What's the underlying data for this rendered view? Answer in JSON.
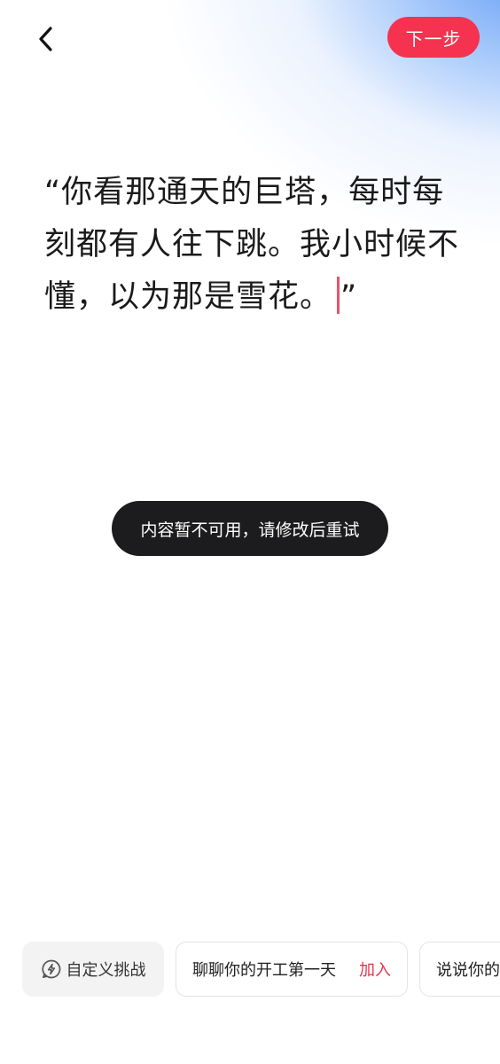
{
  "header": {
    "back_icon": "chevron-left-icon",
    "next_label": "下一步",
    "accent_color": "#f5324f"
  },
  "editor": {
    "text": "“你看那通天的巨塔，每时每刻都有人往下跳。我小时候不懂，以为那是雪花。",
    "closing_quote": "”",
    "caret_color": "#f0506a"
  },
  "toast": {
    "message": "内容暂不可用，请修改后重试"
  },
  "topics": {
    "custom": {
      "icon": "lightning-chat-icon",
      "label": "自定义挑战"
    },
    "items": [
      {
        "label": "聊聊你的开工第一天",
        "action": "加入"
      },
      {
        "label": "说说你的"
      }
    ]
  }
}
